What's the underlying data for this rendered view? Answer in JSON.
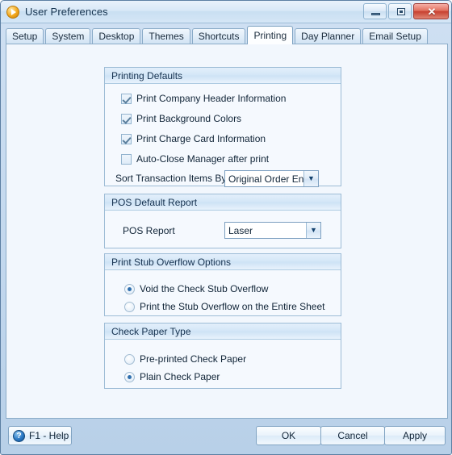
{
  "window": {
    "title": "User Preferences",
    "icon": "play-circle-icon",
    "buttons": {
      "minimize": "minimize-icon",
      "maximize": "maximize-icon",
      "close": "✕"
    }
  },
  "tabs": [
    {
      "label": "Setup",
      "active": false
    },
    {
      "label": "System",
      "active": false
    },
    {
      "label": "Desktop",
      "active": false
    },
    {
      "label": "Themes",
      "active": false
    },
    {
      "label": "Shortcuts",
      "active": false
    },
    {
      "label": "Printing",
      "active": true
    },
    {
      "label": "Day Planner",
      "active": false
    },
    {
      "label": "Email Setup",
      "active": false
    }
  ],
  "groups": {
    "printing_defaults": {
      "title": "Printing Defaults",
      "checkboxes": [
        {
          "label": "Print Company Header Information",
          "checked": true
        },
        {
          "label": "Print Background Colors",
          "checked": true
        },
        {
          "label": "Print Charge Card Information",
          "checked": true
        },
        {
          "label": "Auto-Close Manager after print",
          "checked": false
        }
      ],
      "sort_label": "Sort Transaction Items By",
      "sort_value": "Original Order Entered",
      "sort_arrow": "▼"
    },
    "pos_default_report": {
      "title": "POS Default Report",
      "report_label": "POS Report",
      "report_value": "Laser",
      "report_arrow": "▼"
    },
    "print_stub_overflow": {
      "title": "Print Stub Overflow Options",
      "options": [
        {
          "label": "Void the Check Stub Overflow",
          "selected": true
        },
        {
          "label": "Print the Stub Overflow on the Entire Sheet",
          "selected": false
        }
      ]
    },
    "check_paper_type": {
      "title": "Check Paper Type",
      "options": [
        {
          "label": "Pre-printed Check Paper",
          "selected": false
        },
        {
          "label": "Plain Check Paper",
          "selected": true
        }
      ]
    }
  },
  "footer": {
    "help_label": "F1 - Help",
    "help_glyph": "?",
    "ok_label": "OK",
    "cancel_label": "Cancel",
    "apply_label": "Apply"
  },
  "colors": {
    "window_frame": "#b8d0e8",
    "title_bar": "#d8e8f7",
    "content_bg": "#f2f7fd",
    "group_header": "#d3e6f7",
    "accent_blue": "#2f6fae",
    "close_red": "#c74030"
  }
}
